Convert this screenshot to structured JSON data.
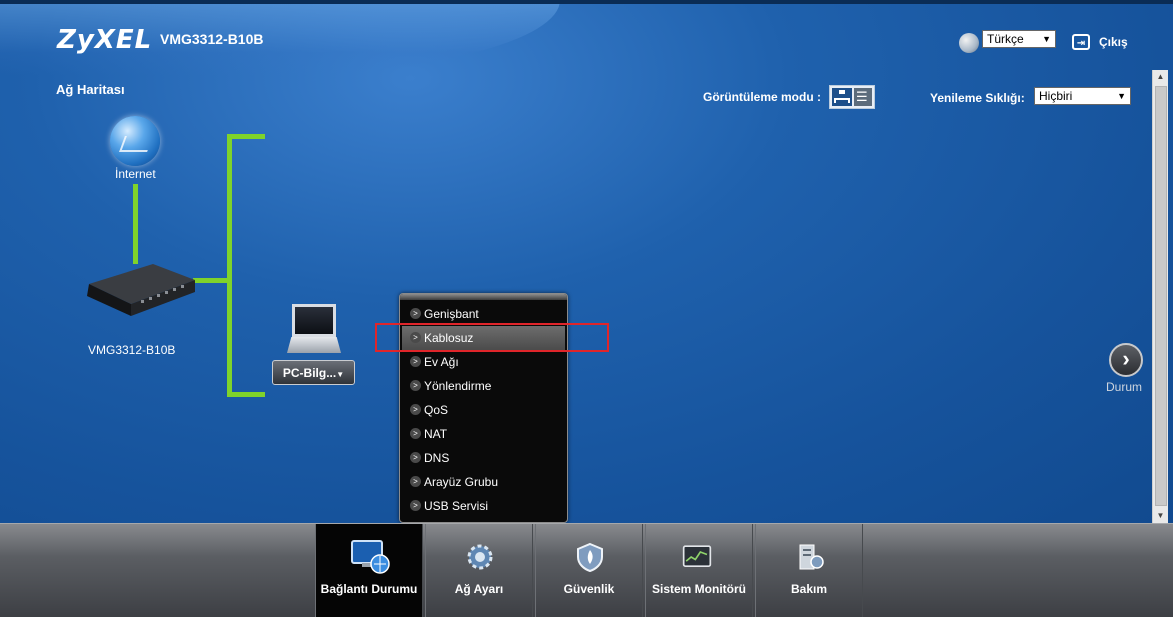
{
  "header": {
    "brand": "ZyXEL",
    "model": "VMG3312-B10B",
    "language": "Türkçe",
    "logout": "Çıkış"
  },
  "network_map": {
    "title": "Ağ Haritası",
    "view_mode_label": "Görüntüleme modu :",
    "refresh_label": "Yenileme Sıklığı:",
    "refresh_value": "Hiçbiri",
    "internet_label": "İnternet",
    "router_label": "VMG3312-B10B",
    "pc_button_label": "PC-Bilg...",
    "next_label": "Durum"
  },
  "menu": {
    "items": [
      "Genişbant",
      "Kablosuz",
      "Ev Ağı",
      "Yönlendirme",
      "QoS",
      "NAT",
      "DNS",
      "Arayüz Grubu",
      "USB Servisi"
    ],
    "selected": "Kablosuz"
  },
  "bottom_tabs": {
    "items": [
      "Bağlantı Durumu",
      "Ağ Ayarı",
      "Güvenlik",
      "Sistem Monitörü",
      "Bakım"
    ],
    "active": "Bağlantı Durumu"
  },
  "colors": {
    "accent_blue": "#1f61ad",
    "link_green": "#7fd32b",
    "highlight_red": "#e0252a"
  }
}
